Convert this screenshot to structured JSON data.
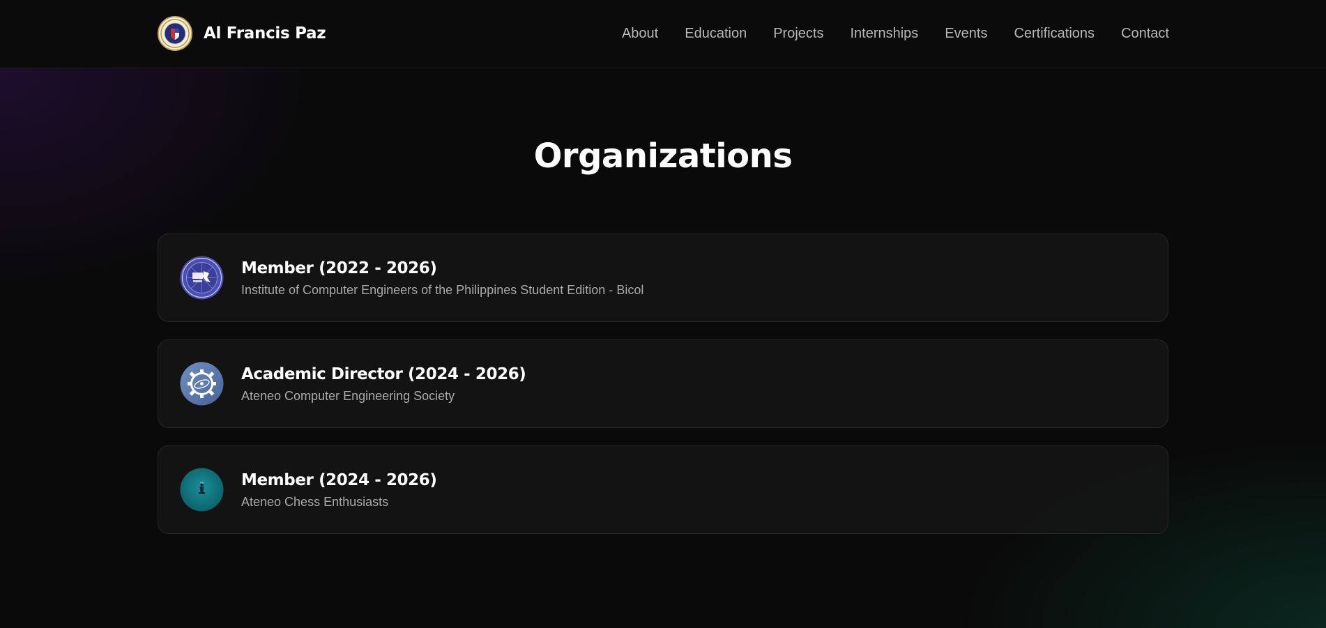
{
  "header": {
    "brand_name": "Al Francis Paz",
    "nav": [
      "About",
      "Education",
      "Projects",
      "Internships",
      "Events",
      "Certifications",
      "Contact"
    ]
  },
  "main": {
    "title": "Organizations",
    "organizations": [
      {
        "role": "Member (2022 - 2026)",
        "name": "Institute of Computer Engineers of the Philippines Student Edition - Bicol",
        "logo_icon": "icpep-logo-icon",
        "logo_color": "#4a4fb0"
      },
      {
        "role": "Academic Director (2024 - 2026)",
        "name": "Ateneo Computer Engineering Society",
        "logo_icon": "gear-logo-icon",
        "logo_color": "#5d78a8"
      },
      {
        "role": "Member (2024 - 2026)",
        "name": "Ateneo Chess Enthusiasts",
        "logo_icon": "chess-logo-icon",
        "logo_color": "#0f7b86"
      }
    ]
  },
  "colors": {
    "background": "#0a0a0a",
    "card_background": "#161616",
    "card_border": "#262626",
    "nav_text": "#b8b8b8",
    "subtitle_text": "#a9a9a9",
    "glow_purple": "#2e104a",
    "glow_green": "#0b3428"
  }
}
